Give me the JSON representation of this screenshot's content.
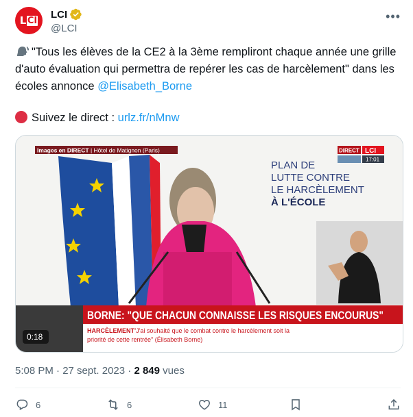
{
  "tweet": {
    "author_name": "LCI",
    "author_handle": "@LCI",
    "logo_text_l": "L",
    "logo_text_ci": "CI",
    "text_quote": "\"Tous les élèves de la CE2 à la 3ème rempliront chaque année une grille d'auto évaluation qui permettra de repérer les cas de harcèlement\"",
    "text_rest": " dans les écoles annonce ",
    "mention": "@Elisabeth_Borne",
    "live_prefix": "Suivez le direct : ",
    "live_link": "urlz.fr/nMnw",
    "timestamp": "5:08 PM · 27 sept. 2023 · ",
    "views_count": "2 849",
    "views_label": " vues"
  },
  "media": {
    "top_banner_bold": "Images en DIRECT",
    "top_banner_rest": " | Hôtel de Matignon (Paris)",
    "direct_label": "DIRECT",
    "channel_logo": "LCI",
    "clock": "17:01",
    "backdrop_line1": "PLAN DE",
    "backdrop_line2": "LUTTE CONTRE",
    "backdrop_line3": "LE HARCÈLEMENT",
    "backdrop_line4": "À L'ÉCOLE",
    "headline": "BORNE: \"QUE CHACUN CONNAISSE LES RISQUES ENCOURUS\"",
    "sub_tag": "HARCÈLEMENT",
    "sub_text1": "\"J'ai souhaité que le combat contre le harcèlement soit la",
    "sub_text2": "priorité de cette rentrée\" (Élisabeth Borne)",
    "duration": "0:18"
  },
  "actions": {
    "replies": "6",
    "reposts": "6",
    "likes": "11"
  },
  "colors": {
    "accent": "#1d9bf0",
    "lci_red": "#e3141f",
    "verified_gold": "#e2b719"
  }
}
